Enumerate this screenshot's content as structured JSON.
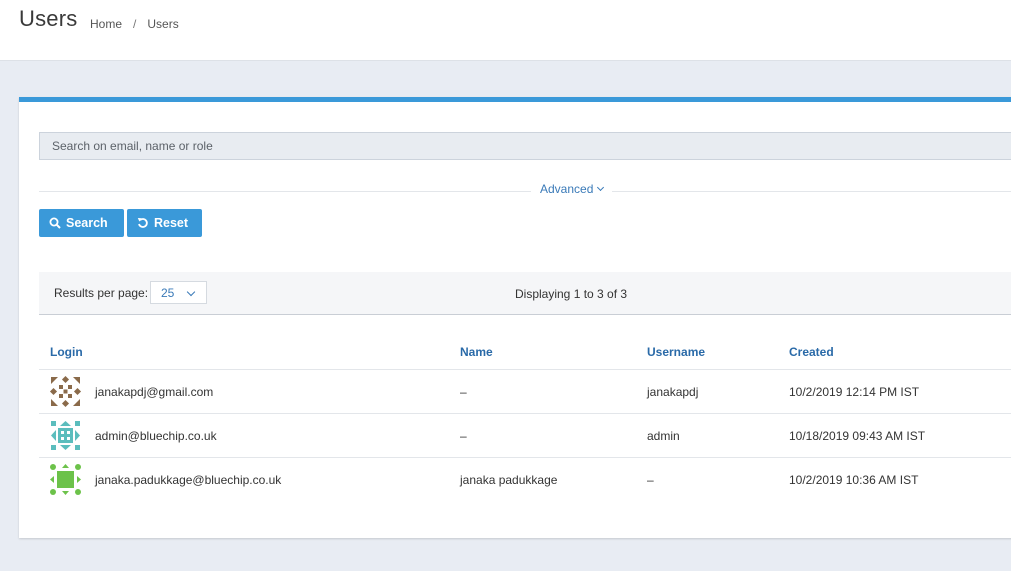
{
  "header": {
    "title": "Users",
    "breadcrumb": [
      "Home",
      "Users"
    ],
    "separator": "/"
  },
  "search": {
    "placeholder": "Search on email, name or role",
    "advanced_label": "Advanced",
    "search_button": "Search",
    "reset_button": "Reset"
  },
  "pager": {
    "results_per_page_label": "Results per page:",
    "results_per_page_value": "25",
    "displaying_text": "Displaying 1 to 3 of 3"
  },
  "table": {
    "columns": [
      "Login",
      "Name",
      "Username",
      "Created"
    ],
    "rows": [
      {
        "login": "janakapdj@gmail.com",
        "name": "–",
        "username": "janakapdj",
        "created": "10/2/2019 12:14 PM IST",
        "avatar_color": "#8a6a4a"
      },
      {
        "login": "admin@bluechip.co.uk",
        "name": "–",
        "username": "admin",
        "created": "10/18/2019 09:43 AM IST",
        "avatar_color": "#5bbdbd"
      },
      {
        "login": "janaka.padukkage@bluechip.co.uk",
        "name": "janaka padukkage",
        "username": "–",
        "created": "10/2/2019 10:36 AM IST",
        "avatar_color": "#6cc24a"
      }
    ]
  },
  "colors": {
    "accent": "#3a99d9",
    "link": "#2a6aa8",
    "background": "#e8ecf3"
  },
  "icons": {
    "search": "magnifier-icon",
    "reset": "undo-icon",
    "advanced": "chevron-down-icon",
    "select": "chevron-down-icon"
  }
}
